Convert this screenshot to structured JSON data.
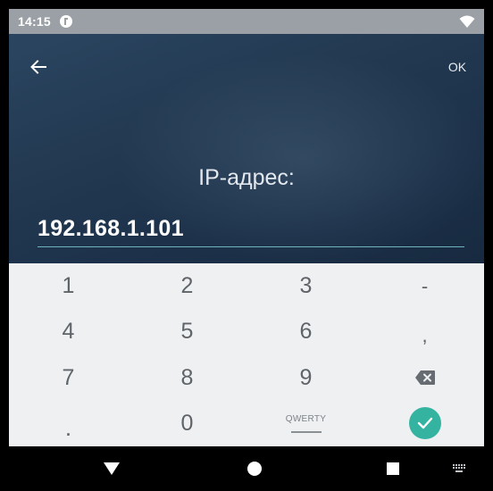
{
  "status_bar": {
    "time": "14:15",
    "icons": [
      "app-notification-icon",
      "wifi-icon"
    ]
  },
  "header": {
    "back_icon": "arrow-left-icon",
    "ok_label": "OK",
    "field_label": "IP-адрес:",
    "ip_value": "192.168.1.101"
  },
  "keypad": {
    "row1": [
      "1",
      "2",
      "3",
      "-"
    ],
    "row2": [
      "4",
      "5",
      "6",
      ","
    ],
    "row3": [
      "7",
      "8",
      "9"
    ],
    "row4": [
      ".",
      "0"
    ],
    "qwerty_label": "QWERTY",
    "backspace_icon": "backspace-icon",
    "confirm_icon": "checkmark-icon"
  },
  "nav_bar": {
    "icons": [
      "back-triangle-icon",
      "home-circle-icon",
      "recents-square-icon",
      "keyboard-icon"
    ]
  },
  "colors": {
    "header_bg": "#233a52",
    "status_bar_bg": "#9aa0a6",
    "keypad_bg": "#eef0f2",
    "accent": "#35b3a1",
    "input_underline": "#6fb3bd",
    "key_text": "#5f6469"
  }
}
